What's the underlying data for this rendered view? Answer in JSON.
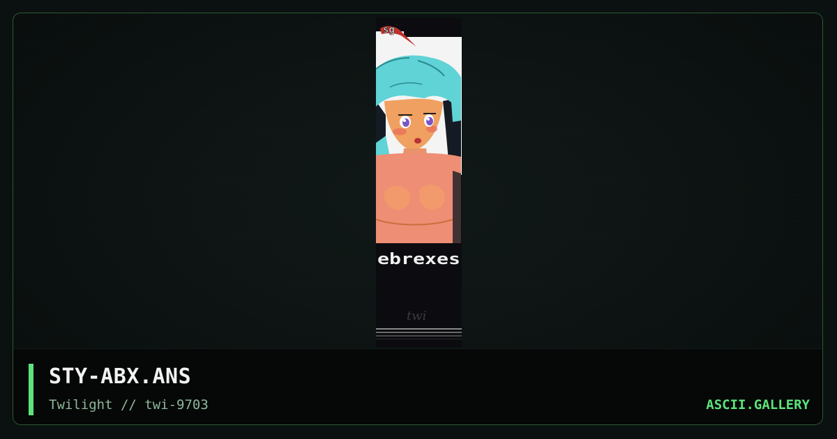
{
  "artwork": {
    "title": "STY-ABX.ANS",
    "credit": "Twilight // twi-9703",
    "preview_logo_text": "sg",
    "preview_wordmark": "ebrexes",
    "preview_signature": "twi"
  },
  "site": {
    "brand": "ASCII.GALLERY"
  },
  "colors": {
    "accent": "#5ee27a",
    "border": "#2b5a33",
    "background": "#0b1110"
  }
}
